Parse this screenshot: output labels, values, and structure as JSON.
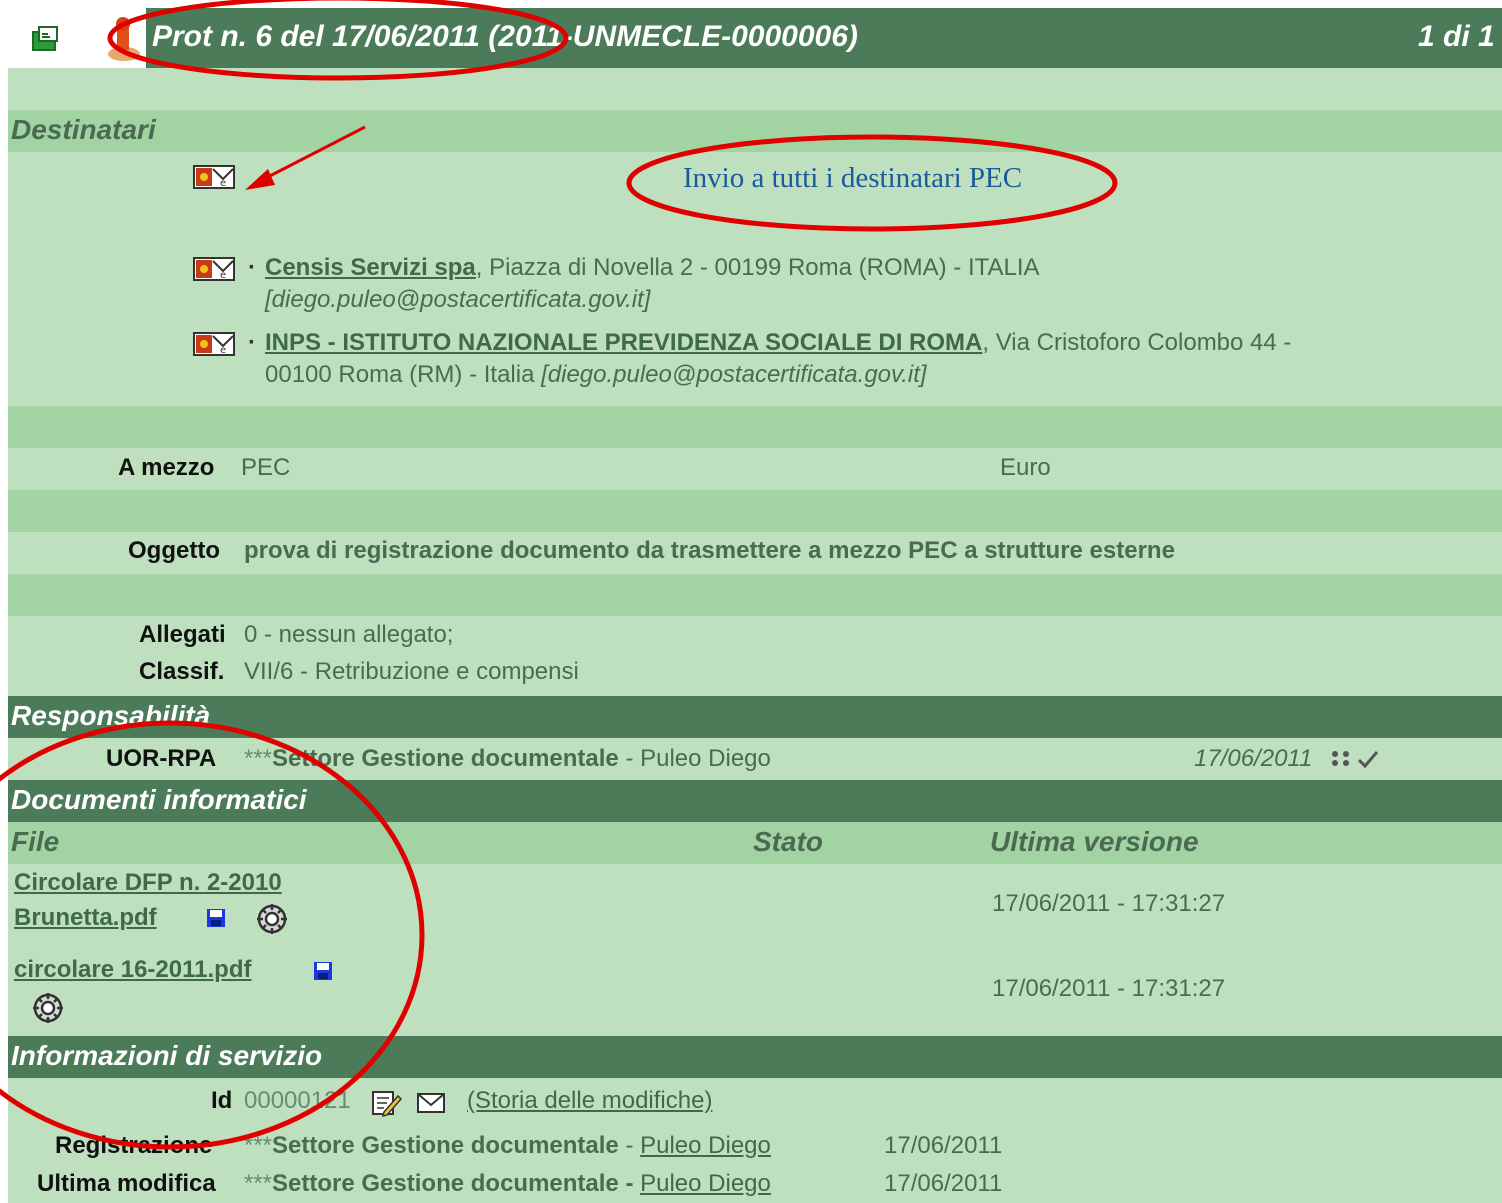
{
  "header": {
    "title": "Prot n. 6 del 17/06/2011  (2011-UNMECLE-0000006)",
    "pager": "1 di 1"
  },
  "destinatari": {
    "section_title": "Destinatari",
    "send_all_link": "Invio a tutti i destinatari PEC",
    "recipients": [
      {
        "bullet": "·",
        "name": "Censis Servizi spa",
        "address_line1": ", Piazza di Novella 2 - 00199 Roma (ROMA) - ITALIA",
        "email": "[diego.puleo@postacertificata.gov.it]"
      },
      {
        "bullet": "·",
        "name": "INPS - ISTITUTO NAZIONALE PREVIDENZA SOCIALE DI ROMA",
        "address_line1": ", Via Cristoforo Colombo 44 -",
        "address_line2": "00100 Roma (RM) - Italia ",
        "email": "[diego.puleo@postacertificata.gov.it]"
      }
    ]
  },
  "details": {
    "a_mezzo_label": "A mezzo",
    "a_mezzo_value": "PEC",
    "currency": "Euro",
    "oggetto_label": "Oggetto",
    "oggetto_value": "prova di registrazione documento da trasmettere a mezzo PEC a strutture esterne",
    "allegati_label": "Allegati",
    "allegati_value": "0 - nessun allegato;",
    "classif_label": "Classif.",
    "classif_value": "VII/6 - Retribuzione e compensi"
  },
  "responsabilita": {
    "section_title": "Responsabilità",
    "label": "UOR-RPA",
    "stars": "***",
    "office": "Settore Gestione documentale",
    "person": " - Puleo Diego",
    "date": "17/06/2011"
  },
  "documenti": {
    "section_title": "Documenti informatici",
    "columns": {
      "file": "File",
      "stato": "Stato",
      "ultima_versione": "Ultima versione"
    },
    "files": [
      {
        "name_line1": "Circolare DFP n. 2-2010",
        "name_line2": "Brunetta.pdf",
        "version": "17/06/2011 - 17:31:27"
      },
      {
        "name_line1": "circolare 16-2011.pdf",
        "version": "17/06/2011 - 17:31:27"
      }
    ]
  },
  "servizio": {
    "section_title": "Informazioni di servizio",
    "id_label": "Id",
    "id_value": "00000121",
    "history_link": "(Storia delle modifiche)",
    "registrazione_label": "Registrazione",
    "modifica_label": "Ultima modifica",
    "stars": "***",
    "office": "Settore Gestione documentale",
    "dash": " - ",
    "person": "Puleo Diego",
    "registrazione_date": "17/06/2011",
    "modifica_date": "17/06/2011"
  },
  "colors": {
    "dark_band": "#4b7b59",
    "mid_band": "#a2d3a2",
    "background": "#bfe0bf",
    "annotation": "#e00000",
    "link_blue": "#1a5a9a"
  },
  "icons": [
    "save-document-icon",
    "stamp-icon",
    "pec-mail-icon",
    "floppy-disk-icon",
    "gear-sign-icon",
    "edit-document-icon",
    "envelope-icon",
    "checkmark-icon",
    "users-icon"
  ]
}
